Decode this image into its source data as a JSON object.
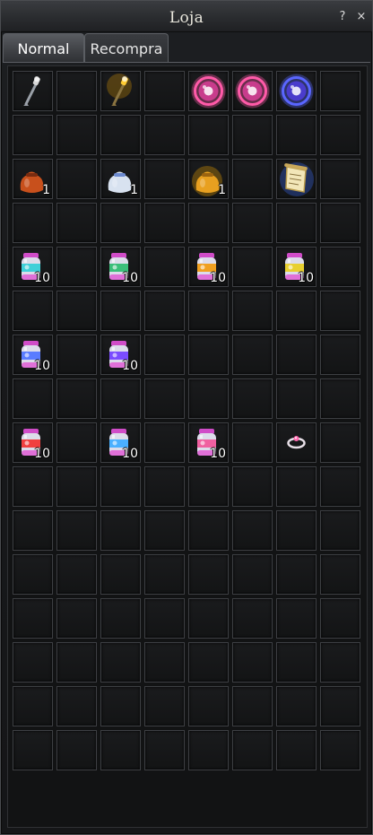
{
  "window": {
    "title": "Loja",
    "help_label": "?",
    "close_label": "×"
  },
  "tabs": [
    {
      "label": "Normal",
      "active": true
    },
    {
      "label": "Recompra",
      "active": false
    }
  ],
  "grid": {
    "columns": 8,
    "rows": 16
  },
  "items": [
    {
      "slot": 0,
      "icon": "grey-staff-icon",
      "qty": ""
    },
    {
      "slot": 2,
      "icon": "gold-staff-icon",
      "qty": ""
    },
    {
      "slot": 4,
      "icon": "pink-orb-icon",
      "qty": ""
    },
    {
      "slot": 5,
      "icon": "pink-orb-icon",
      "qty": ""
    },
    {
      "slot": 6,
      "icon": "blue-orb-icon",
      "qty": ""
    },
    {
      "slot": 16,
      "icon": "orange-pouch-icon",
      "qty": "1"
    },
    {
      "slot": 18,
      "icon": "silver-pouch-icon",
      "qty": "1"
    },
    {
      "slot": 20,
      "icon": "gold-pouch-icon",
      "qty": "1"
    },
    {
      "slot": 22,
      "icon": "scroll-icon",
      "qty": ""
    },
    {
      "slot": 32,
      "icon": "cyan-potion-jar-icon",
      "qty": "10"
    },
    {
      "slot": 34,
      "icon": "green-potion-jar-icon",
      "qty": "10"
    },
    {
      "slot": 36,
      "icon": "amber-potion-jar-icon",
      "qty": "10"
    },
    {
      "slot": 38,
      "icon": "yellow-potion-jar-icon",
      "qty": "10"
    },
    {
      "slot": 48,
      "icon": "blue-potion-jar-icon",
      "qty": "10"
    },
    {
      "slot": 50,
      "icon": "purple-potion-jar-icon",
      "qty": "10"
    },
    {
      "slot": 64,
      "icon": "red-potion-jar-icon",
      "qty": "10"
    },
    {
      "slot": 66,
      "icon": "sky-potion-jar-icon",
      "qty": "10"
    },
    {
      "slot": 68,
      "icon": "pink-potion-jar-icon",
      "qty": "10"
    },
    {
      "slot": 70,
      "icon": "ring-icon",
      "qty": ""
    }
  ],
  "colors": {
    "jar_cyan": "#3fd0d8",
    "jar_green": "#3bbf7a",
    "jar_amber": "#f0a020",
    "jar_yellow": "#e8d030",
    "jar_blue": "#5a7cff",
    "jar_purple": "#7b4cff",
    "jar_red": "#f04040",
    "jar_sky": "#4ab0ff",
    "jar_pink": "#f060a0"
  }
}
